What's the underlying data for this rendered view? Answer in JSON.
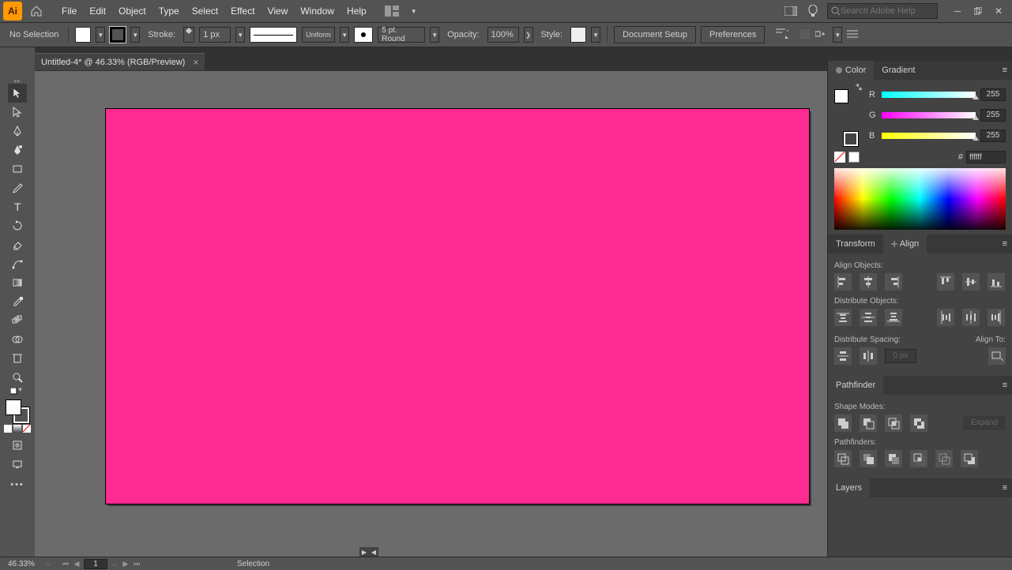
{
  "app": {
    "logo_text": "Ai"
  },
  "menu": [
    "File",
    "Edit",
    "Object",
    "Type",
    "Select",
    "Effect",
    "View",
    "Window",
    "Help"
  ],
  "search": {
    "placeholder": "Search Adobe Help"
  },
  "control": {
    "selection": "No Selection",
    "stroke_label": "Stroke:",
    "stroke_value": "1 px",
    "profile_label": "Uniform",
    "brush_label": "5 pt. Round",
    "opacity_label": "Opacity:",
    "opacity_value": "100%",
    "style_label": "Style:",
    "doc_setup": "Document Setup",
    "prefs": "Preferences"
  },
  "document": {
    "tab_title": "Untitled-4* @ 46.33% (RGB/Preview)"
  },
  "panels": {
    "color": {
      "title": "Color",
      "gradient_tab": "Gradient",
      "r_label": "R",
      "g_label": "G",
      "b_label": "B",
      "r": "255",
      "g": "255",
      "b": "255",
      "hex": "ffffff"
    },
    "transform_tab": "Transform",
    "align": {
      "title": "Align",
      "align_objects": "Align Objects:",
      "distribute_objects": "Distribute Objects:",
      "distribute_spacing": "Distribute Spacing:",
      "align_to": "Align To:",
      "space_value": "0 px"
    },
    "pathfinder": {
      "title": "Pathfinder",
      "shape_modes": "Shape Modes:",
      "expand": "Expand",
      "pathfinders": "Pathfinders:"
    },
    "layers": {
      "title": "Layers"
    }
  },
  "status": {
    "zoom": "46.33%",
    "page": "1",
    "tool": "Selection"
  }
}
